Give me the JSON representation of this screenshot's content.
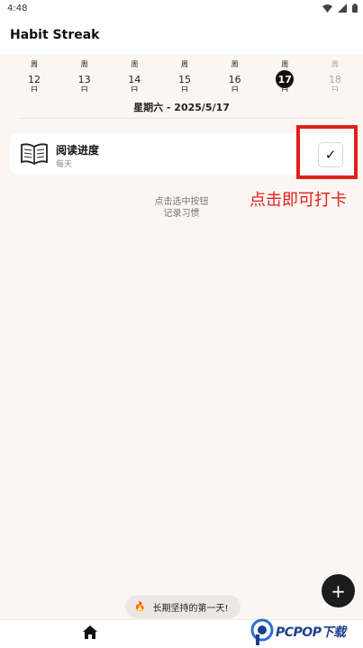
{
  "status": {
    "time": "4:48",
    "icons": [
      "wifi-icon",
      "signal-icon",
      "battery-icon"
    ]
  },
  "app": {
    "title": "Habit Streak"
  },
  "week": [
    {
      "weekday": "周",
      "num": "12",
      "dayname": "日",
      "state": "normal"
    },
    {
      "weekday": "周",
      "num": "13",
      "dayname": "日",
      "state": "normal"
    },
    {
      "weekday": "周",
      "num": "14",
      "dayname": "日",
      "state": "normal"
    },
    {
      "weekday": "周",
      "num": "15",
      "dayname": "日",
      "state": "normal"
    },
    {
      "weekday": "周",
      "num": "16",
      "dayname": "日",
      "state": "normal"
    },
    {
      "weekday": "周",
      "num": "17",
      "dayname": "日",
      "state": "selected"
    },
    {
      "weekday": "周",
      "num": "18",
      "dayname": "日",
      "state": "future"
    }
  ],
  "selected_date_label": "星期六 - 2025/5/17",
  "habits": [
    {
      "name": "阅读进度",
      "frequency": "每天",
      "icon": "book-icon",
      "check": "✓"
    }
  ],
  "annotation": "点击即可打卡",
  "hint": {
    "line1": "点击选中按钮",
    "line2": "记录习惯"
  },
  "fab": {
    "label": "+",
    "icon": "plus-icon"
  },
  "toast": {
    "emoji": "🔥",
    "text": "长期坚持的第一天!"
  },
  "nav": {
    "home_icon": "home-icon"
  },
  "watermark": {
    "text": "PCPOP下载"
  },
  "colors": {
    "accent": "#e0201b",
    "background": "#fbf6f1",
    "selected_day": "#111111",
    "watermark": "#1e3f8c"
  }
}
